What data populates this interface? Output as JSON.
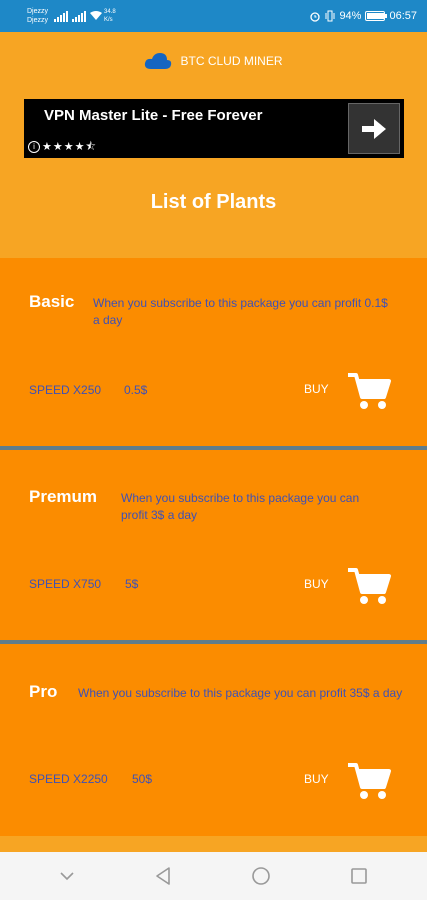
{
  "status_bar": {
    "carrier1": "Djezzy",
    "carrier2": "Djezzy",
    "net_speed_value": "34.8",
    "net_speed_unit": "K/s",
    "battery": "94%",
    "time": "06:57"
  },
  "header": {
    "app_name": "BTC CLUD MINER"
  },
  "ad": {
    "title": "VPN Master Lite - Free Forever",
    "rating_stars": 4.5,
    "info_glyph": "i"
  },
  "page": {
    "title": "List of Plants"
  },
  "plans": [
    {
      "name": "Basic",
      "description": "When you subscribe to this package you can profit 0.1$ a day",
      "speed": "SPEED X250",
      "price": "0.5$",
      "buy_label": "BUY"
    },
    {
      "name": "Premum",
      "description": "When you subscribe to this package you can profit 3$ a day",
      "speed": "SPEED X750",
      "price": "5$",
      "buy_label": "BUY"
    },
    {
      "name": "Pro",
      "description": "When you subscribe to this package you can profit 35$ a day",
      "speed": "SPEED X2250",
      "price": "50$",
      "buy_label": "BUY"
    }
  ],
  "colors": {
    "status_bar": "#1E88C7",
    "page_background": "#F7A523",
    "card_background": "#FB8C00",
    "separator": "#607D8B",
    "accent_text": "#3F51B5",
    "cloud": "#1565C0"
  },
  "icons": {
    "logo": "cloud-icon",
    "ad_action": "arrow-right-icon",
    "buy": "shopping-cart-icon",
    "nav_down": "chevron-down-icon",
    "nav_back": "back-triangle-icon",
    "nav_home": "home-circle-icon",
    "nav_recents": "recents-square-icon"
  }
}
